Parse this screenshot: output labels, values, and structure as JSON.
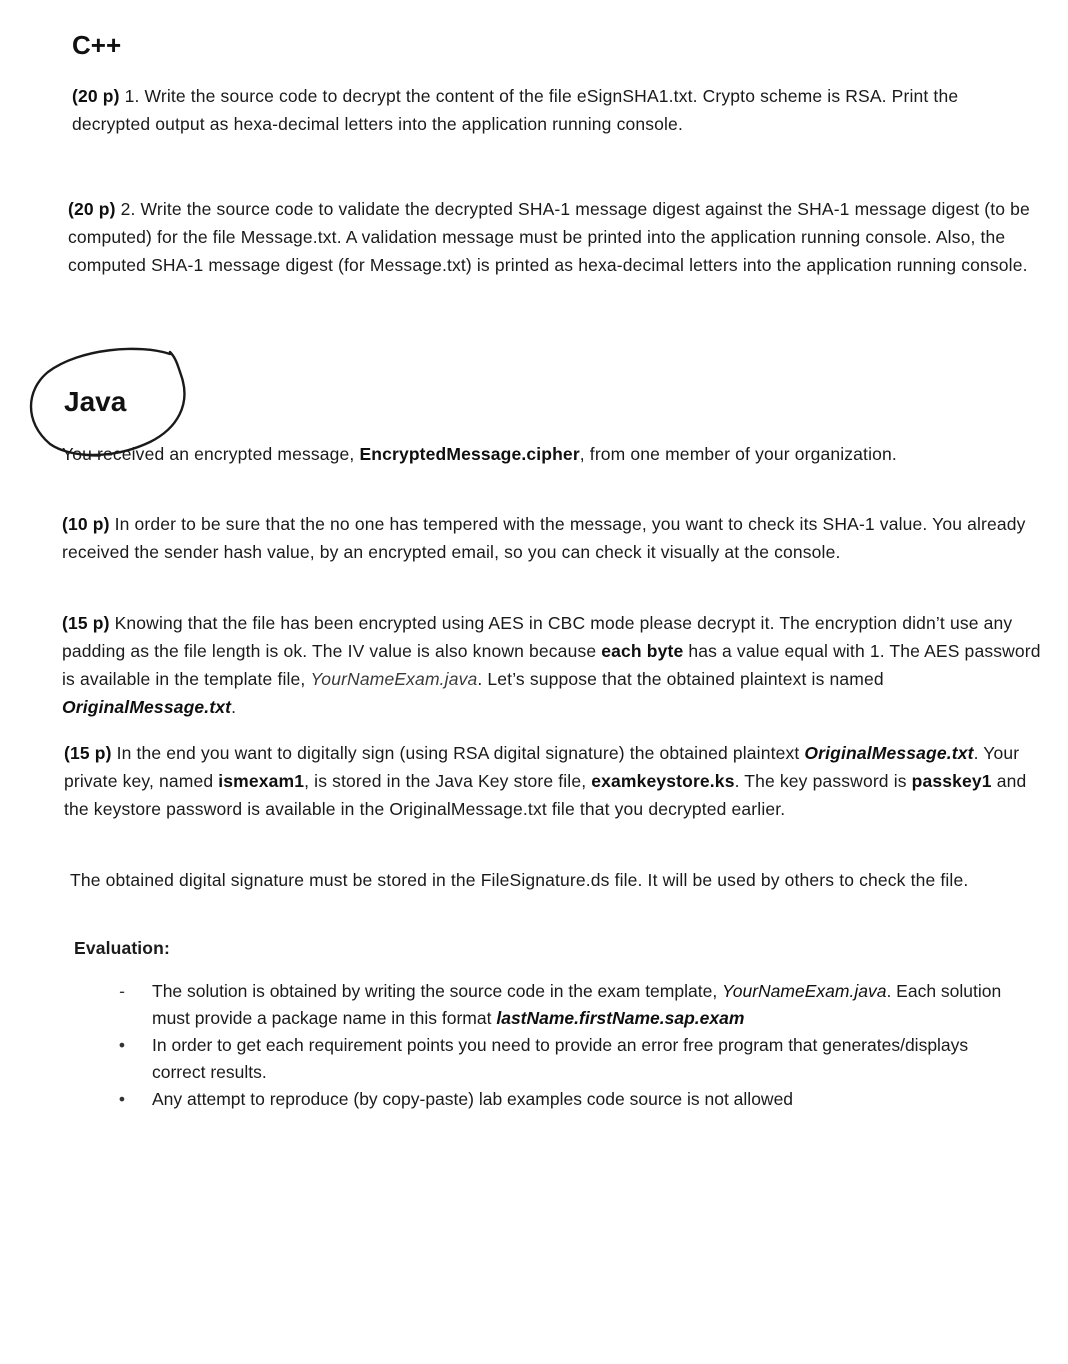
{
  "cpp": {
    "heading": "C++",
    "q1": {
      "points": "(20 p)",
      "text": " 1. Write the source code to decrypt the content of the file eSignSHA1.txt. Crypto scheme is RSA. Print the decrypted output as hexa-decimal letters into the application running console."
    },
    "q2": {
      "points": "(20 p)",
      "text": " 2. Write the source code to validate the decrypted SHA-1 message digest against the SHA-1 message digest (to be computed) for the file Message.txt. A validation message must be printed into the application running console. Also, the computed SHA-1 message digest (for Message.txt) is printed as hexa-decimal letters into the application running console."
    }
  },
  "java": {
    "heading": "Java",
    "intro": {
      "part1": "You received an encrypted message, ",
      "file": "EncryptedMessage.cipher",
      "part2": ", from one member of your organization."
    },
    "q1": {
      "points": "(10 p)",
      "text": " In order to be sure that the no one has tempered with the message, you want to check its SHA-1 value. You already received the sender hash value, by an encrypted email, so you can check it visually at the console."
    },
    "q2": {
      "points": "(15 p)",
      "part1": " Knowing that the file has been encrypted using AES in CBC mode please decrypt it. The encryption didn’t use any padding as the file length is ok. The IV value is also known because ",
      "bold": "each byte",
      "part2": " has a value equal with 1. The AES password is available in the template file, ",
      "template": "YourNameExam.java",
      "part3": ". Let’s suppose that the obtained plaintext is named ",
      "plaintext": "OriginalMessage.txt",
      "part4": "."
    },
    "q3": {
      "points": "(15 p)",
      "part1": " In the end you want to digitally sign (using RSA digital signature) the obtained plaintext ",
      "plaintext": "OriginalMessage.txt",
      "part2": ". Your private key, named ",
      "alias": "ismexam1",
      "part3": ", is stored in the Java Key store file, ",
      "keystore": "examkeystore.ks",
      "part4": ". The key password is ",
      "keypass": "passkey1",
      "part5": " and the keystore password is available in the OriginalMessage.txt file that you decrypted earlier."
    },
    "signature_note": "The obtained digital signature must be stored in the FileSignature.ds file. It will be used by others to check the file.",
    "evaluation": {
      "heading": "Evaluation:",
      "items": [
        {
          "mark": "-",
          "part1": "The solution is obtained by writing the source code in the exam template, ",
          "template": "YourNameExam.java",
          "part2": ". Each solution must provide a package name in this format ",
          "format": "lastName.firstName.sap.exam"
        },
        {
          "mark": "•",
          "text": "In order to get each requirement points you need to provide an error free program that generates/displays correct results."
        },
        {
          "mark": "•",
          "text": "Any attempt to reproduce (by copy-paste) lab examples code source is not allowed"
        }
      ]
    }
  }
}
